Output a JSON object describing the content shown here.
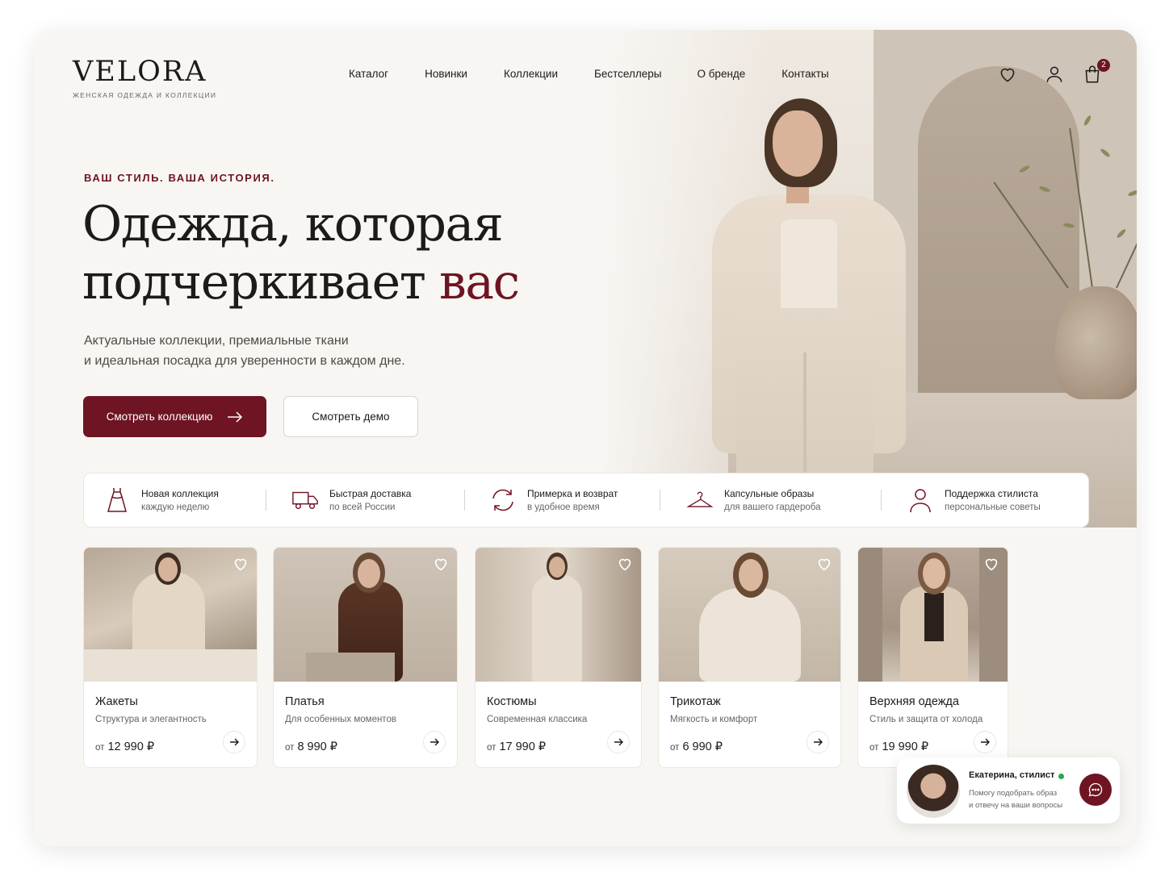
{
  "brand": {
    "name": "VELORA",
    "tagline": "женская одежда и коллекции"
  },
  "nav": [
    "Каталог",
    "Новинки",
    "Коллекции",
    "Бестселлеры",
    "О бренде",
    "Контакты"
  ],
  "header": {
    "cart_count": "2",
    "icons": [
      "heart-icon",
      "user-icon",
      "bag-icon"
    ]
  },
  "hero": {
    "eyebrow": "ВАШ СТИЛЬ. ВАША ИСТОРИЯ.",
    "headline_line1": "Одежда, которая",
    "headline_line2": "подчеркивает",
    "headline_accent": "вас",
    "lead_line1": "Актуальные коллекции, премиальные ткани",
    "lead_line2": "и идеальная посадка для уверенности в каждом дне.",
    "primary_cta": "Смотреть коллекцию",
    "secondary_cta": "Смотреть демо"
  },
  "features": [
    {
      "title": "Новая коллекция",
      "sub": "каждую неделю",
      "icon": "dress-icon"
    },
    {
      "title": "Быстрая доставка",
      "sub": "по всей России",
      "icon": "truck-icon"
    },
    {
      "title": "Примерка и возврат",
      "sub": "в удобное время",
      "icon": "refresh-icon"
    },
    {
      "title": "Капсульные образы",
      "sub": "для вашего гардероба",
      "icon": "hanger-icon"
    },
    {
      "title": "Поддержка стилиста",
      "sub": "персональные советы",
      "icon": "person-icon"
    }
  ],
  "products": [
    {
      "title": "Жакеты",
      "sub": "Структура и элегантность",
      "from": "от",
      "price": "12 990 ₽"
    },
    {
      "title": "Платья",
      "sub": "Для особенных моментов",
      "from": "от",
      "price": "8 990 ₽"
    },
    {
      "title": "Костюмы",
      "sub": "Современная классика",
      "from": "от",
      "price": "17 990 ₽"
    },
    {
      "title": "Трикотаж",
      "sub": "Мягкость и комфорт",
      "from": "от",
      "price": "6 990 ₽"
    },
    {
      "title": "Верхняя одежда",
      "sub": "Стиль и защита от холода",
      "from": "от",
      "price": "19 990 ₽"
    }
  ],
  "stylist": {
    "name": "Екатерина, стилист",
    "message_line1": "Помогу подобрать образ",
    "message_line2": "и отвечу на ваши вопросы",
    "status": "online"
  },
  "colors": {
    "accent": "#6e1423",
    "background": "#f8f6f3",
    "online": "#27a94a"
  }
}
